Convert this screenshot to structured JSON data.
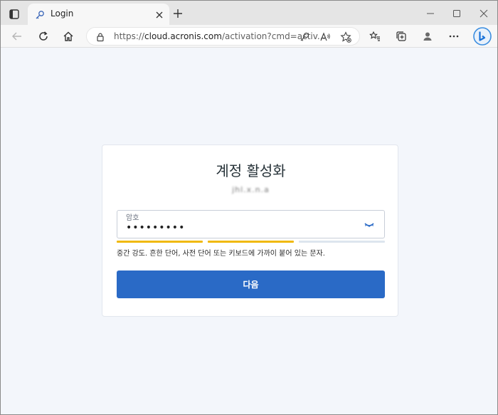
{
  "browser": {
    "tab": {
      "title": "Login"
    },
    "address": {
      "prefix": "https://",
      "host": "cloud.acronis.com",
      "path": "/activation?cmd=activ..."
    }
  },
  "activation": {
    "title": "계정 활성화",
    "username": "jhl.x.n.a",
    "password": {
      "label": "암호",
      "value": "•••••••••"
    },
    "strength": {
      "hint": "중간 강도. 흔한 단어, 사전 단어 또는 키보드에 가까이 붙어 있는 문자.",
      "level": 2,
      "max": 3,
      "colors": {
        "filled": "#f0b90b",
        "empty": "#dde5ee"
      }
    },
    "next_label": "다음"
  },
  "colors": {
    "primary": "#2a6ac6"
  }
}
